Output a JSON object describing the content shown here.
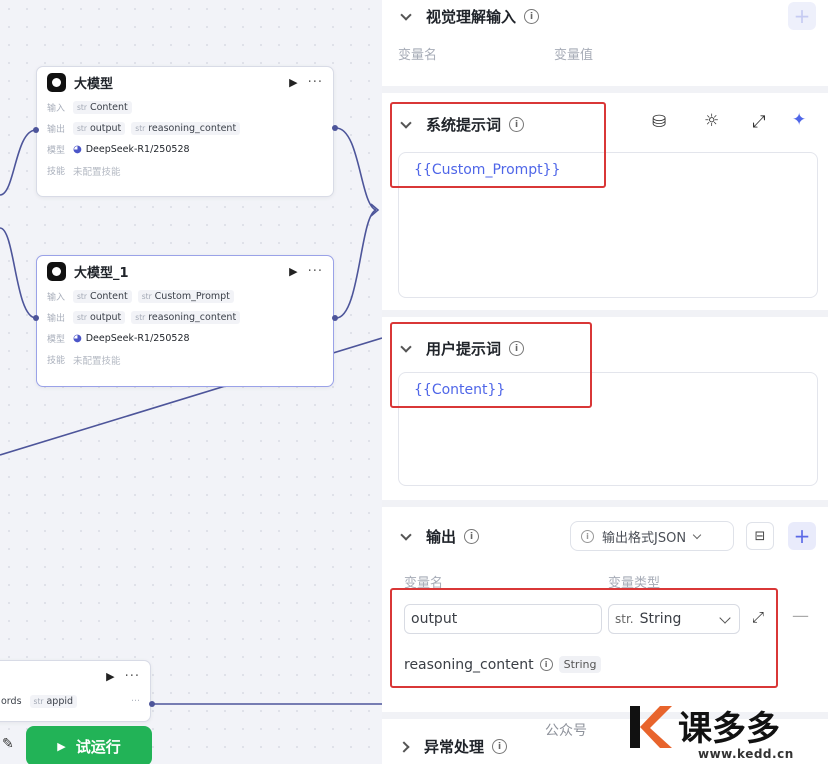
{
  "canvas": {
    "node1": {
      "title": "大模型",
      "input_label": "输入",
      "output_label": "输出",
      "model_label": "模型",
      "skill_label": "技能",
      "inputs": [
        {
          "type": "str",
          "name": "Content"
        }
      ],
      "outputs": [
        {
          "type": "str",
          "name": "output"
        },
        {
          "type": "str",
          "name": "reasoning_content"
        }
      ],
      "model": "DeepSeek-R1/250528",
      "skill": "未配置技能"
    },
    "node2": {
      "title": "大模型_1",
      "input_label": "输入",
      "output_label": "输出",
      "model_label": "模型",
      "skill_label": "技能",
      "inputs": [
        {
          "type": "str",
          "name": "Content"
        },
        {
          "type": "str",
          "name": "Custom_Prompt"
        }
      ],
      "outputs": [
        {
          "type": "str",
          "name": "output"
        },
        {
          "type": "str",
          "name": "reasoning_content"
        }
      ],
      "model": "DeepSeek-R1/250528",
      "skill": "未配置技能"
    },
    "node3": {
      "row_text": "ords",
      "tag_type": "str",
      "tag_name": "appid"
    },
    "run_button_label": "试运行"
  },
  "panel": {
    "vision_input": {
      "title": "视觉理解输入",
      "col_name": "变量名",
      "col_value": "变量值"
    },
    "system_prompt": {
      "title": "系统提示词",
      "value": "{{Custom_Prompt}}"
    },
    "user_prompt": {
      "title": "用户提示词",
      "value": "{{Content}}"
    },
    "output": {
      "title": "输出",
      "format_label": "输出格式JSON",
      "col_name": "变量名",
      "col_type": "变量类型",
      "row1_name": "output",
      "row1_type_prefix": "str.",
      "row1_type": "String",
      "row2_name": "reasoning_content",
      "row2_type": "String"
    },
    "exception": {
      "title": "异常处理"
    }
  },
  "watermark": {
    "text": "公众号",
    "brand": "课多多",
    "domain": "www.kedd.cn"
  },
  "colors": {
    "accent": "#4f66e8",
    "run_green": "#22b357",
    "highlight_red": "#d93737",
    "edge": "#4d559a"
  }
}
